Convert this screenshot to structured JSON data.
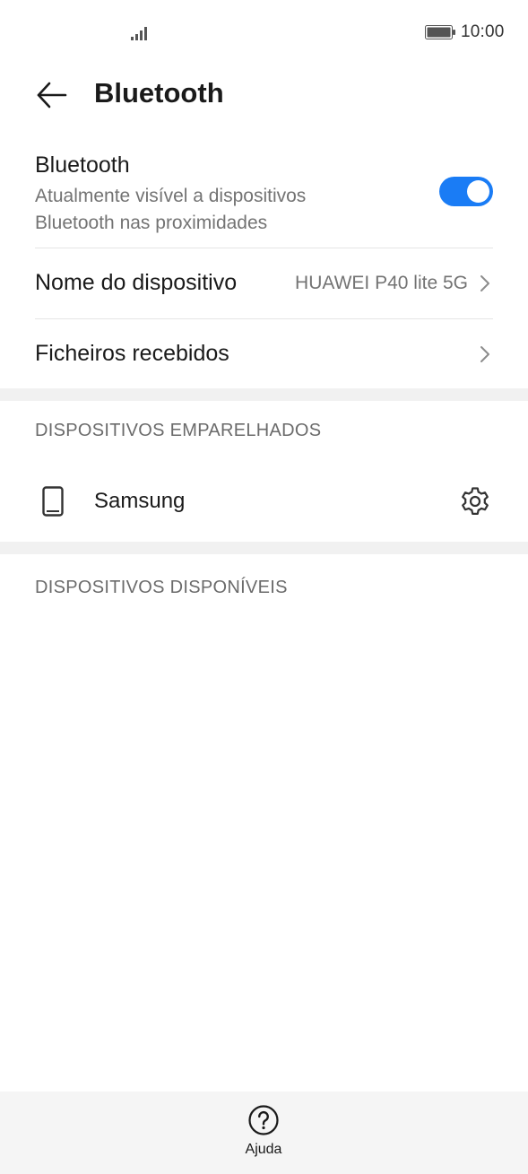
{
  "status_bar": {
    "time": "10:00"
  },
  "header": {
    "title": "Bluetooth"
  },
  "bluetooth": {
    "label": "Bluetooth",
    "subtitle_line1": "Atualmente visível a dispositivos",
    "subtitle_line2": "Bluetooth nas proximidades",
    "enabled": true
  },
  "device_name": {
    "label": "Nome do dispositivo",
    "value": "HUAWEI P40 lite 5G"
  },
  "received_files": {
    "label": "Ficheiros recebidos"
  },
  "paired": {
    "header": "DISPOSITIVOS EMPARELHADOS",
    "devices": [
      {
        "name": "Samsung",
        "icon": "phone-icon"
      }
    ]
  },
  "available": {
    "header": "DISPOSITIVOS DISPONÍVEIS"
  },
  "bottom_bar": {
    "help_label": "Ajuda"
  },
  "colors": {
    "accent": "#1a7cf5",
    "secondary_text": "#737373",
    "divider": "#f1f1f1"
  }
}
